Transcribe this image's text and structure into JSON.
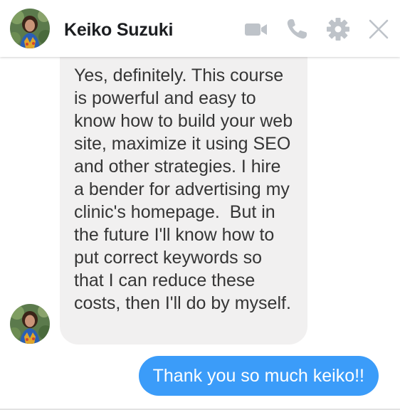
{
  "header": {
    "contact_name": "Keiko Suzuki",
    "icons": [
      "video-camera-icon",
      "phone-icon",
      "gear-icon",
      "close-icon"
    ],
    "icon_color": "#bec3c9"
  },
  "messages": {
    "incoming": {
      "text": "Yes, definitely. This course is powerful and easy to know how to build your web site, maximize it using SEO and other strategies. I hire a bender for advertising my clinic's homepage.  But in the future I'll know how to put correct keywords so that I can reduce these costs, then I'll do by myself.",
      "bubble_color": "#f1f0f0",
      "text_color": "#353535"
    },
    "outgoing": {
      "text": "Thank you so much keiko!!",
      "bubble_color": "#3b9cf9",
      "text_color": "#ffffff"
    }
  }
}
